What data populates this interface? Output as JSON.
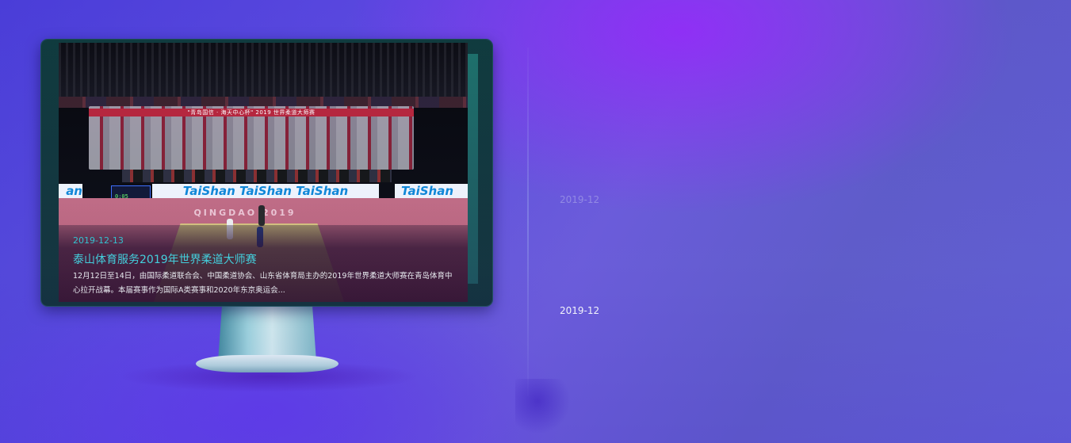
{
  "colors": {
    "accent": "#3fd3dd",
    "background": "#5a48df",
    "text_light": "#ffffff"
  },
  "monitor": {
    "screen": {
      "banner_title": "\"青岛国信 · 海天中心杯\" 2019 世界柔道大师赛",
      "taishan_board": "TaiShan TaiShan TaiShan",
      "taishan_left": "an",
      "taishan_right": "TaiShan",
      "scoreboard": "0:05",
      "mat_text": "QINGDAO 2019"
    },
    "news": {
      "date": "2019-12-13",
      "title": "泰山体育服务2019年世界柔道大师赛",
      "summary": "12月12日至14日，由国际柔道联合会、中国柔道协会、山东省体育局主办的2019年世界柔道大师赛在青岛体育中心拉开战幕。本届赛事作为国际A类赛事和2020年东京奥运会..."
    }
  },
  "timeline": {
    "faint_year": "2019-12",
    "active_year": "2019-12"
  }
}
